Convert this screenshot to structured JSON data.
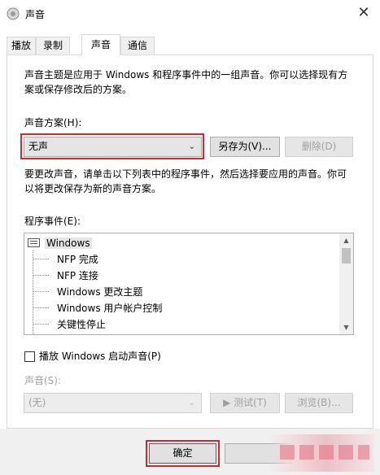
{
  "window": {
    "title": "声音",
    "close": "✕"
  },
  "tabs": [
    {
      "label": "播放"
    },
    {
      "label": "录制"
    },
    {
      "label": "声音"
    },
    {
      "label": "通信"
    }
  ],
  "intro": {
    "line1": "声音主题是应用于 Windows 和程序事件中的一组声音。你可以选择现有方",
    "line2": "案或保存修改后的方案。"
  },
  "scheme": {
    "label": "声音方案(H):",
    "value": "无声",
    "save_as": "另存为(V)...",
    "delete": "删除(D)"
  },
  "hint": {
    "line1": "要更改声音，请单击以下列表中的程序事件，然后选择要应用的声音。你可",
    "line2": "以将更改保存为新的声音方案。"
  },
  "events": {
    "label": "程序事件(E):",
    "root": "Windows",
    "items": [
      {
        "label": "NFP 完成"
      },
      {
        "label": "NFP 连接"
      },
      {
        "label": "Windows 更改主题"
      },
      {
        "label": "Windows 用户帐户控制"
      },
      {
        "label": "关键性停止"
      }
    ]
  },
  "startup": {
    "label": "播放 Windows 启动声音(P)",
    "checked": false
  },
  "sound": {
    "label": "声音(S):",
    "value": "(无)",
    "test": "▶ 测试(T)",
    "browse": "浏览(B)..."
  },
  "footer": {
    "ok": "确定"
  },
  "colors": {
    "highlight_box": "#d0282e",
    "ok_border": "#0078d7"
  }
}
